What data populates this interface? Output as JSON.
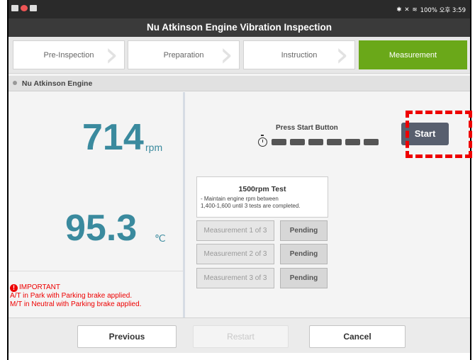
{
  "status_bar": {
    "right_text": "100% 오후 3:59",
    "icons": [
      "image-icon",
      "record-icon",
      "calendar-icon",
      "bluetooth-icon",
      "mute-icon",
      "wifi-icon",
      "battery-icon"
    ]
  },
  "title": "Nu Atkinson Engine Vibration Inspection",
  "steps": [
    {
      "label": "Pre-Inspection",
      "active": false
    },
    {
      "label": "Preparation",
      "active": false
    },
    {
      "label": "Instruction",
      "active": false
    },
    {
      "label": "Measurement",
      "active": true
    }
  ],
  "section_title": "Nu Atkinson Engine",
  "readings": {
    "rpm_value": "714",
    "rpm_unit": "rpm",
    "temp_value": "95.3",
    "temp_unit": "℃"
  },
  "important": {
    "heading": "IMPORTANT",
    "line1": "A/T in Park with Parking brake applied.",
    "line2": "M/T in Neutral with Parking brake applied."
  },
  "measurement": {
    "prompt": "Press Start Button",
    "progress_segments": 6,
    "progress_filled": 0,
    "start_label": "Start",
    "test_title": "1500rpm Test",
    "test_desc_line1": "-  Maintain engine rpm between",
    "test_desc_line2": "1,400-1,600 until 3 tests are completed.",
    "rows": [
      {
        "label": "Measurement 1 of 3",
        "status": "Pending"
      },
      {
        "label": "Measurement 2 of 3",
        "status": "Pending"
      },
      {
        "label": "Measurement 3 of 3",
        "status": "Pending"
      }
    ]
  },
  "footer": {
    "previous": "Previous",
    "restart": "Restart",
    "cancel": "Cancel"
  },
  "colors": {
    "accent_green": "#6aa819",
    "value_teal": "#3a8a9e",
    "warning_red": "#ee0000",
    "start_button": "#585f6e"
  }
}
